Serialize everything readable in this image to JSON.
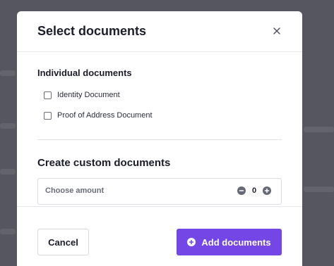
{
  "modal": {
    "title": "Select documents",
    "close_icon": "close-icon"
  },
  "individual": {
    "heading": "Individual documents",
    "items": [
      {
        "label": "Identity Document",
        "checked": false
      },
      {
        "label": "Proof of Address Document",
        "checked": false
      }
    ]
  },
  "custom": {
    "heading": "Create custom documents",
    "amount_label": "Choose amount",
    "amount_value": "0",
    "decrement_icon": "minus-circle-icon",
    "increment_icon": "plus-circle-icon"
  },
  "footer": {
    "cancel_label": "Cancel",
    "add_label": "Add documents",
    "add_icon": "plus-circle-icon"
  },
  "colors": {
    "accent": "#7446e6",
    "overlay": "#5b5c65"
  }
}
